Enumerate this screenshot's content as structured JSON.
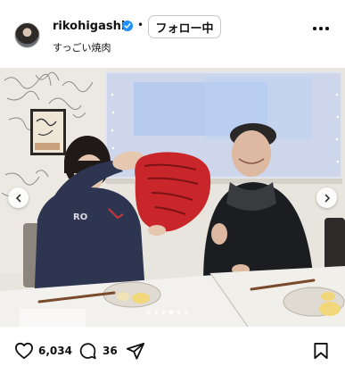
{
  "post": {
    "username": "rikohigashio",
    "separator": "•",
    "follow_label": "フォロー中",
    "caption": "すっごい焼肉"
  },
  "icons": {
    "avatar": "profile-avatar",
    "verified": "verified-badge-icon",
    "more": "more-options-icon",
    "prev": "chevron-left-icon",
    "next": "chevron-right-icon",
    "like": "heart-icon",
    "comment": "comment-bubble-icon",
    "share": "send-icon",
    "save": "bookmark-icon"
  },
  "carousel": {
    "slide_count": 6,
    "active_index": 3
  },
  "stats": {
    "likes": "6,034",
    "comments": "36"
  },
  "colors": {
    "verified": "#1e90ff",
    "glove": "#c8262a"
  }
}
